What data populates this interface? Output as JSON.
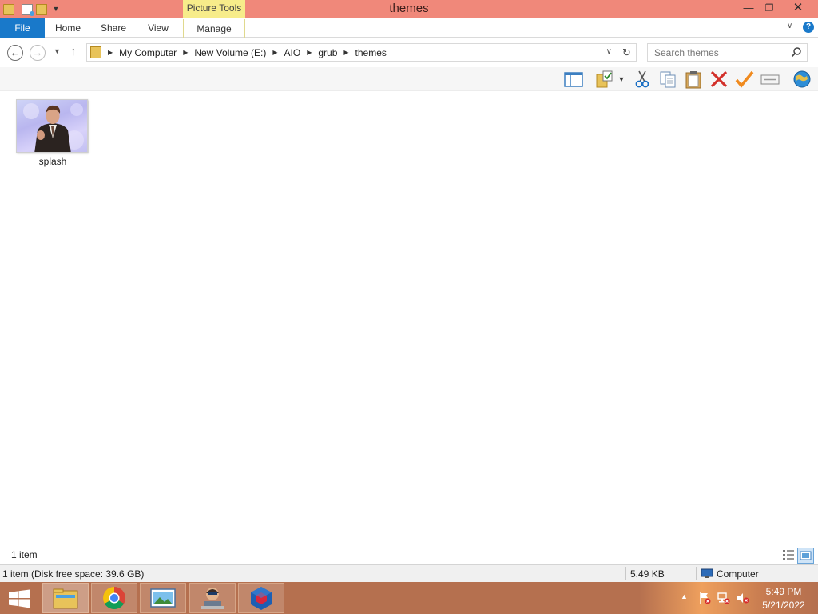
{
  "window": {
    "title": "themes",
    "contextual_tab_group": "Picture Tools"
  },
  "ribbon": {
    "tabs": [
      {
        "label": "File"
      },
      {
        "label": "Home"
      },
      {
        "label": "Share"
      },
      {
        "label": "View"
      },
      {
        "label": "Manage"
      }
    ]
  },
  "address": {
    "breadcrumbs": [
      "My Computer",
      "New Volume (E:)",
      "AIO",
      "grub",
      "themes"
    ]
  },
  "search": {
    "placeholder": "Search themes"
  },
  "toolbar": {
    "icons": [
      "preview-pane-icon",
      "folder-checkmark-icon",
      "cut-icon",
      "copy-icon",
      "paste-icon",
      "delete-icon",
      "checkmark-icon",
      "rename-icon",
      "globe-icon"
    ]
  },
  "files": [
    {
      "name": "splash",
      "type": "image"
    }
  ],
  "content_footer": {
    "item_count": "1 item"
  },
  "statusbar": {
    "left": "1 item (Disk free space: 39.6 GB)",
    "size": "5.49 KB",
    "location": "Computer"
  },
  "taskbar": {
    "apps": [
      "file-explorer-icon",
      "chrome-icon",
      "photo-viewer-icon",
      "user-app-icon",
      "box-app-icon"
    ],
    "time": "5:49 PM",
    "date": "5/21/2022"
  },
  "colors": {
    "titlebar": "#f0887a",
    "contextual_tab": "#f7ec8a",
    "file_tab": "#1979ca",
    "taskbar": "#b5704f"
  }
}
